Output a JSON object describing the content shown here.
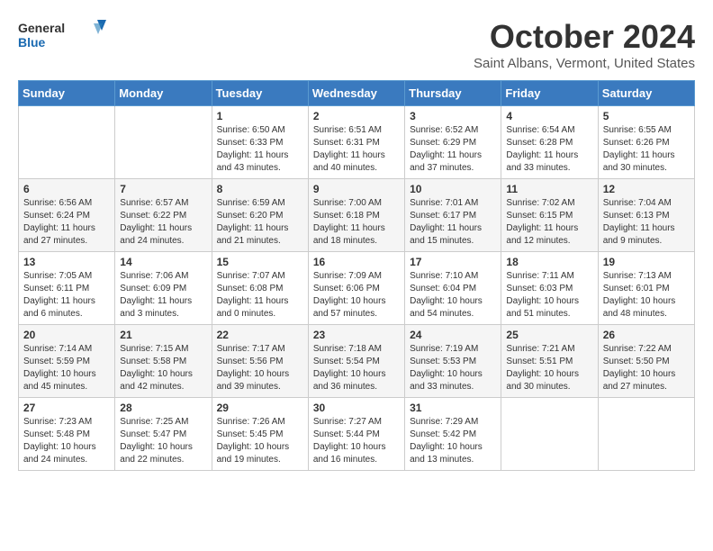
{
  "header": {
    "logo_general": "General",
    "logo_blue": "Blue",
    "month_title": "October 2024",
    "location": "Saint Albans, Vermont, United States"
  },
  "weekdays": [
    "Sunday",
    "Monday",
    "Tuesday",
    "Wednesday",
    "Thursday",
    "Friday",
    "Saturday"
  ],
  "weeks": [
    [
      {
        "day": "",
        "sunrise": "",
        "sunset": "",
        "daylight": ""
      },
      {
        "day": "",
        "sunrise": "",
        "sunset": "",
        "daylight": ""
      },
      {
        "day": "1",
        "sunrise": "Sunrise: 6:50 AM",
        "sunset": "Sunset: 6:33 PM",
        "daylight": "Daylight: 11 hours and 43 minutes."
      },
      {
        "day": "2",
        "sunrise": "Sunrise: 6:51 AM",
        "sunset": "Sunset: 6:31 PM",
        "daylight": "Daylight: 11 hours and 40 minutes."
      },
      {
        "day": "3",
        "sunrise": "Sunrise: 6:52 AM",
        "sunset": "Sunset: 6:29 PM",
        "daylight": "Daylight: 11 hours and 37 minutes."
      },
      {
        "day": "4",
        "sunrise": "Sunrise: 6:54 AM",
        "sunset": "Sunset: 6:28 PM",
        "daylight": "Daylight: 11 hours and 33 minutes."
      },
      {
        "day": "5",
        "sunrise": "Sunrise: 6:55 AM",
        "sunset": "Sunset: 6:26 PM",
        "daylight": "Daylight: 11 hours and 30 minutes."
      }
    ],
    [
      {
        "day": "6",
        "sunrise": "Sunrise: 6:56 AM",
        "sunset": "Sunset: 6:24 PM",
        "daylight": "Daylight: 11 hours and 27 minutes."
      },
      {
        "day": "7",
        "sunrise": "Sunrise: 6:57 AM",
        "sunset": "Sunset: 6:22 PM",
        "daylight": "Daylight: 11 hours and 24 minutes."
      },
      {
        "day": "8",
        "sunrise": "Sunrise: 6:59 AM",
        "sunset": "Sunset: 6:20 PM",
        "daylight": "Daylight: 11 hours and 21 minutes."
      },
      {
        "day": "9",
        "sunrise": "Sunrise: 7:00 AM",
        "sunset": "Sunset: 6:18 PM",
        "daylight": "Daylight: 11 hours and 18 minutes."
      },
      {
        "day": "10",
        "sunrise": "Sunrise: 7:01 AM",
        "sunset": "Sunset: 6:17 PM",
        "daylight": "Daylight: 11 hours and 15 minutes."
      },
      {
        "day": "11",
        "sunrise": "Sunrise: 7:02 AM",
        "sunset": "Sunset: 6:15 PM",
        "daylight": "Daylight: 11 hours and 12 minutes."
      },
      {
        "day": "12",
        "sunrise": "Sunrise: 7:04 AM",
        "sunset": "Sunset: 6:13 PM",
        "daylight": "Daylight: 11 hours and 9 minutes."
      }
    ],
    [
      {
        "day": "13",
        "sunrise": "Sunrise: 7:05 AM",
        "sunset": "Sunset: 6:11 PM",
        "daylight": "Daylight: 11 hours and 6 minutes."
      },
      {
        "day": "14",
        "sunrise": "Sunrise: 7:06 AM",
        "sunset": "Sunset: 6:09 PM",
        "daylight": "Daylight: 11 hours and 3 minutes."
      },
      {
        "day": "15",
        "sunrise": "Sunrise: 7:07 AM",
        "sunset": "Sunset: 6:08 PM",
        "daylight": "Daylight: 11 hours and 0 minutes."
      },
      {
        "day": "16",
        "sunrise": "Sunrise: 7:09 AM",
        "sunset": "Sunset: 6:06 PM",
        "daylight": "Daylight: 10 hours and 57 minutes."
      },
      {
        "day": "17",
        "sunrise": "Sunrise: 7:10 AM",
        "sunset": "Sunset: 6:04 PM",
        "daylight": "Daylight: 10 hours and 54 minutes."
      },
      {
        "day": "18",
        "sunrise": "Sunrise: 7:11 AM",
        "sunset": "Sunset: 6:03 PM",
        "daylight": "Daylight: 10 hours and 51 minutes."
      },
      {
        "day": "19",
        "sunrise": "Sunrise: 7:13 AM",
        "sunset": "Sunset: 6:01 PM",
        "daylight": "Daylight: 10 hours and 48 minutes."
      }
    ],
    [
      {
        "day": "20",
        "sunrise": "Sunrise: 7:14 AM",
        "sunset": "Sunset: 5:59 PM",
        "daylight": "Daylight: 10 hours and 45 minutes."
      },
      {
        "day": "21",
        "sunrise": "Sunrise: 7:15 AM",
        "sunset": "Sunset: 5:58 PM",
        "daylight": "Daylight: 10 hours and 42 minutes."
      },
      {
        "day": "22",
        "sunrise": "Sunrise: 7:17 AM",
        "sunset": "Sunset: 5:56 PM",
        "daylight": "Daylight: 10 hours and 39 minutes."
      },
      {
        "day": "23",
        "sunrise": "Sunrise: 7:18 AM",
        "sunset": "Sunset: 5:54 PM",
        "daylight": "Daylight: 10 hours and 36 minutes."
      },
      {
        "day": "24",
        "sunrise": "Sunrise: 7:19 AM",
        "sunset": "Sunset: 5:53 PM",
        "daylight": "Daylight: 10 hours and 33 minutes."
      },
      {
        "day": "25",
        "sunrise": "Sunrise: 7:21 AM",
        "sunset": "Sunset: 5:51 PM",
        "daylight": "Daylight: 10 hours and 30 minutes."
      },
      {
        "day": "26",
        "sunrise": "Sunrise: 7:22 AM",
        "sunset": "Sunset: 5:50 PM",
        "daylight": "Daylight: 10 hours and 27 minutes."
      }
    ],
    [
      {
        "day": "27",
        "sunrise": "Sunrise: 7:23 AM",
        "sunset": "Sunset: 5:48 PM",
        "daylight": "Daylight: 10 hours and 24 minutes."
      },
      {
        "day": "28",
        "sunrise": "Sunrise: 7:25 AM",
        "sunset": "Sunset: 5:47 PM",
        "daylight": "Daylight: 10 hours and 22 minutes."
      },
      {
        "day": "29",
        "sunrise": "Sunrise: 7:26 AM",
        "sunset": "Sunset: 5:45 PM",
        "daylight": "Daylight: 10 hours and 19 minutes."
      },
      {
        "day": "30",
        "sunrise": "Sunrise: 7:27 AM",
        "sunset": "Sunset: 5:44 PM",
        "daylight": "Daylight: 10 hours and 16 minutes."
      },
      {
        "day": "31",
        "sunrise": "Sunrise: 7:29 AM",
        "sunset": "Sunset: 5:42 PM",
        "daylight": "Daylight: 10 hours and 13 minutes."
      },
      {
        "day": "",
        "sunrise": "",
        "sunset": "",
        "daylight": ""
      },
      {
        "day": "",
        "sunrise": "",
        "sunset": "",
        "daylight": ""
      }
    ]
  ]
}
